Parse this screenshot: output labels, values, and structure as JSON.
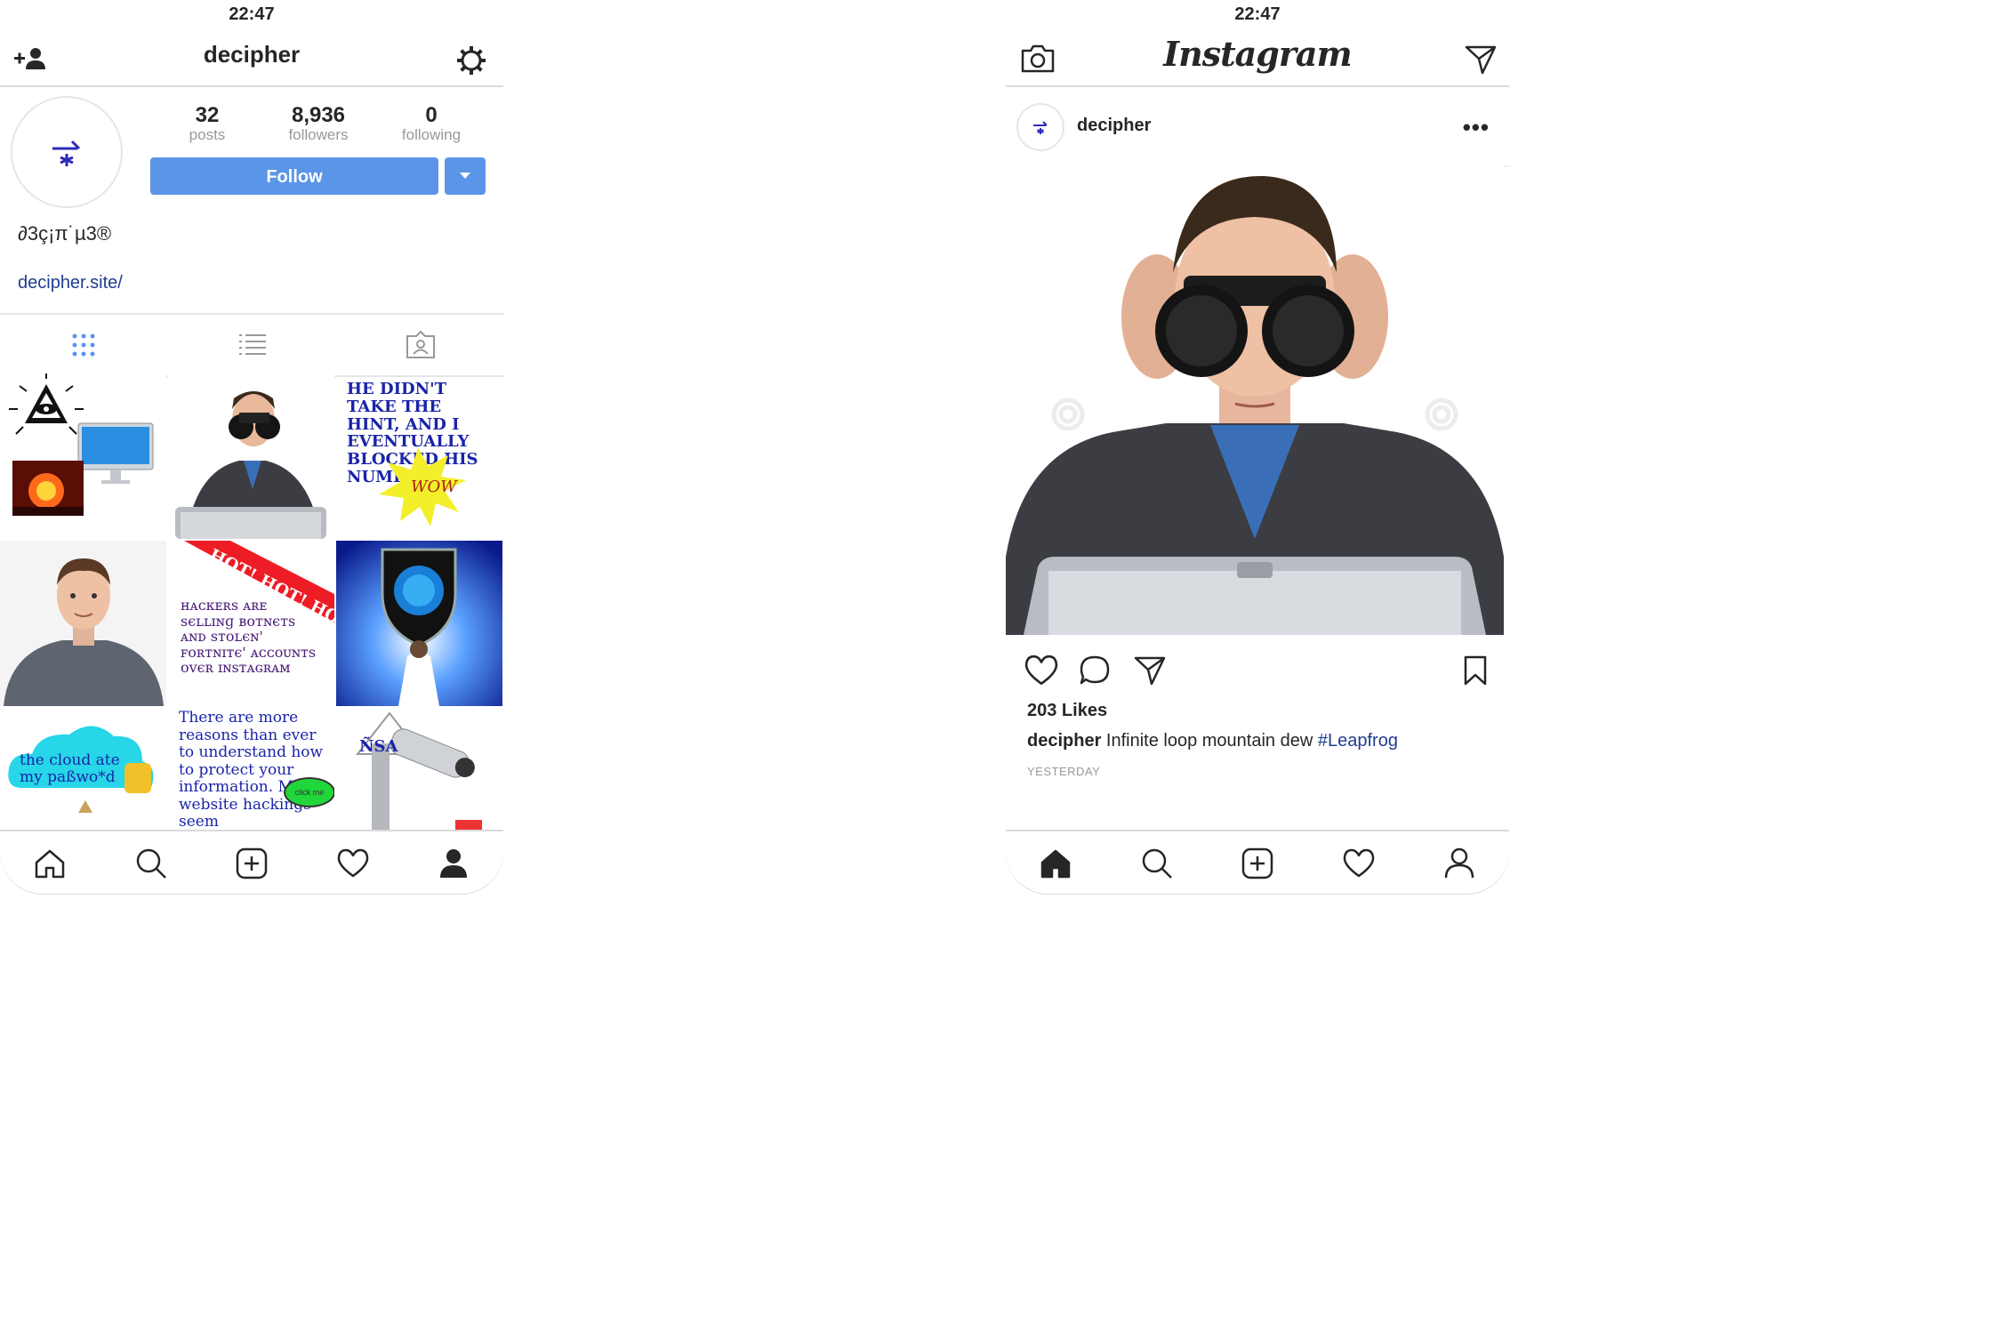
{
  "status": {
    "time": "22:47"
  },
  "profile": {
    "username": "decipher",
    "display_name": "∂3ç¡π˙µ3®",
    "website": "decipher.site/",
    "stats": [
      {
        "num": "32",
        "label": "posts"
      },
      {
        "num": "8,936",
        "label": "followers"
      },
      {
        "num": "0",
        "label": "following"
      }
    ],
    "follow_label": "Follow",
    "icons": {
      "add_user": "add-user-icon",
      "settings": "gear-icon"
    },
    "tabs": [
      "grid-icon",
      "list-icon",
      "tagged-icon"
    ]
  },
  "grid_tiles": {
    "t1": "eye-pyramid-computer-explosion",
    "t2": "man-with-binoculars",
    "t3_text": "HE DIDN'T TAKE THE HINT, AND I EVENTUALLY BLOCKED HIS NUMBER.",
    "t3_badge": "WOW",
    "t4": "man-portrait",
    "t5_banner": "HOT! HOT! HO",
    "t5_text": "ʜᴀᴄᴋᴇʀѕ ᴀʀᴇ ѕєʟʟɪɴɡ ʙᴏᴛɴєᴛѕ ᴀɴᴅ ѕᴛᴏʟєɴ' ꜰᴏʀᴛɴɪᴛє' ᴀᴄᴄᴏᴜɴᴛѕ ᴏᴠєʀ ɪɴѕᴛᴀɢʀᴀᴍ",
    "t6": "shield-globe",
    "t7_text": "the cloud ate my paßwo*d",
    "t8_text": "There are more reasons than ever to understand how to protect your information. Major website hackings seem",
    "t8_badge": "click me",
    "t9_text": "ÑSA"
  },
  "bottom_nav": [
    "home-icon",
    "search-icon",
    "add-icon",
    "heart-icon",
    "profile-icon"
  ],
  "post": {
    "app_title": "Instagram",
    "username": "decipher",
    "likes": "203 Likes",
    "caption_user": "decipher",
    "caption_text": "Infinite loop mountain dew",
    "caption_tag": "#Leapfrog",
    "time_label": "YESTERDAY",
    "more": "•••"
  },
  "colors": {
    "accent": "#5b95e8",
    "link": "#1e3d8f",
    "divider": "#dbdbdb"
  }
}
